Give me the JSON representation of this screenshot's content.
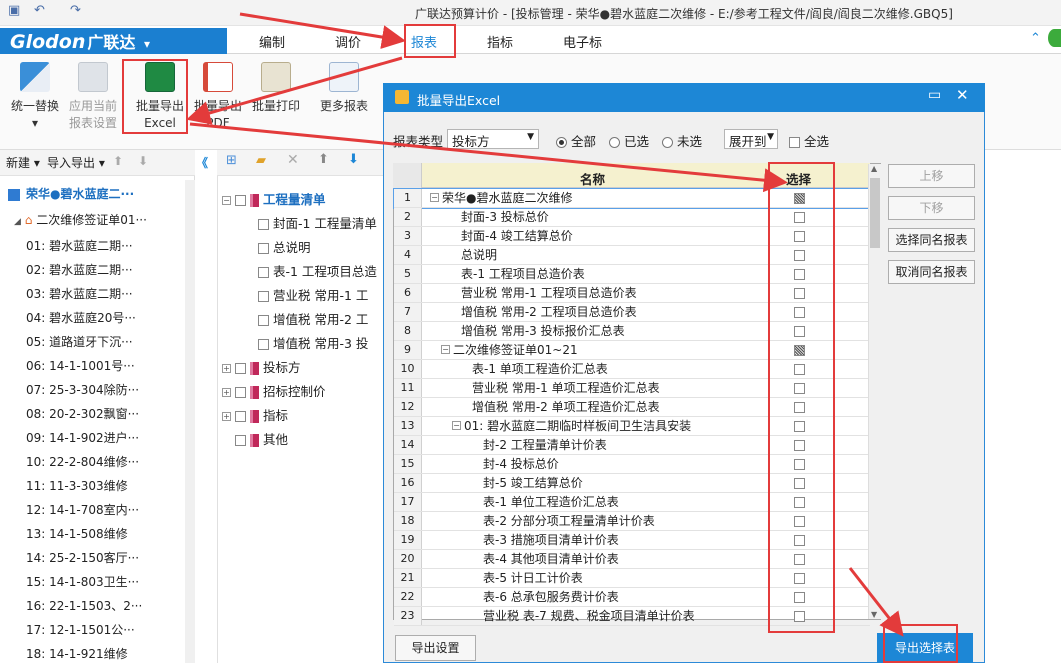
{
  "window": {
    "title": "广联达预算计价 - [投标管理 - 荣华●碧水蓝庭二次维修 - E:/参考工程文件/阎良/阎良二次维修.GBQ5]"
  },
  "brand": {
    "name": "Glodon",
    "cn": "广联达",
    "dropdown": "▾"
  },
  "menu": {
    "tabs": [
      "编制",
      "调价",
      "报表",
      "指标",
      "电子标"
    ],
    "active": "报表"
  },
  "ribbon": {
    "buttons": [
      {
        "label1": "统一替换",
        "label2": "▾",
        "icon": "replace-icon",
        "enabled": true
      },
      {
        "label1": "应用当前",
        "label2": "报表设置",
        "icon": "apply-settings-icon",
        "enabled": false
      },
      {
        "label1": "批量导出",
        "label2": "Excel",
        "icon": "excel-export-icon",
        "enabled": true
      },
      {
        "label1": "批量导出",
        "label2": "PDF",
        "icon": "pdf-export-icon",
        "enabled": true
      },
      {
        "label1": "批量打印",
        "label2": "",
        "icon": "print-icon",
        "enabled": true
      },
      {
        "label1": "更多报表",
        "label2": "",
        "icon": "more-reports-icon",
        "enabled": true
      }
    ]
  },
  "left": {
    "toolbar": {
      "new_label": "新建 ▾",
      "import_export": "导入导出 ▾",
      "collapse": "《"
    },
    "root": "荣华●碧水蓝庭二···",
    "group": "二次维修签证单01···",
    "items": [
      "01: 碧水蓝庭二期···",
      "02: 碧水蓝庭二期···",
      "03: 碧水蓝庭二期···",
      "04: 碧水蓝庭20号···",
      "05: 道路道牙下沉···",
      "06: 14-1-1001号···",
      "07: 25-3-304除防···",
      "08: 20-2-302飘窗···",
      "09: 14-1-902进户···",
      "10: 22-2-804维修···",
      "11: 11-3-303维修",
      "12: 14-1-708室内···",
      "13: 14-1-508维修",
      "14: 25-2-150客厅···",
      "15: 14-1-803卫生···",
      "16: 22-1-1503、2···",
      "17: 12-1-1501公···",
      "18: 14-1-921维修"
    ]
  },
  "middle": {
    "tree": [
      {
        "label": "工程量清单",
        "level": 0,
        "expand": "minus",
        "book": true,
        "bold": true
      },
      {
        "label": "封面-1 工程量清单",
        "level": 1
      },
      {
        "label": "总说明",
        "level": 1
      },
      {
        "label": "表-1 工程项目总造",
        "level": 1
      },
      {
        "label": "营业税 常用-1 工",
        "level": 1
      },
      {
        "label": "增值税 常用-2 工",
        "level": 1
      },
      {
        "label": "增值税 常用-3 投",
        "level": 1
      },
      {
        "label": "投标方",
        "level": 0,
        "expand": "plus",
        "book": true
      },
      {
        "label": "招标控制价",
        "level": 0,
        "expand": "plus",
        "book": true
      },
      {
        "label": "指标",
        "level": 0,
        "expand": "plus",
        "book": true
      },
      {
        "label": "其他",
        "level": 0,
        "book": true
      }
    ]
  },
  "dialog": {
    "title": "批量导出Excel",
    "report_type_label": "报表类型",
    "report_type_value": "投标方",
    "radios": [
      "全部",
      "已选",
      "未选"
    ],
    "radio_selected": "全部",
    "expand_label": "展开到",
    "select_all": "全选",
    "columns": {
      "name": "名称",
      "select": "选择"
    },
    "rows": [
      {
        "n": "1",
        "name": "荣华●碧水蓝庭二次维修",
        "indent": 0,
        "expand": "minus",
        "check": "part"
      },
      {
        "n": "2",
        "name": "封面-3 投标总价",
        "indent": 1
      },
      {
        "n": "3",
        "name": "封面-4 竣工结算总价",
        "indent": 1
      },
      {
        "n": "4",
        "name": "总说明",
        "indent": 1
      },
      {
        "n": "5",
        "name": "表-1 工程项目总造价表",
        "indent": 1
      },
      {
        "n": "6",
        "name": "营业税 常用-1 工程项目总造价表",
        "indent": 1
      },
      {
        "n": "7",
        "name": "增值税 常用-2 工程项目总造价表",
        "indent": 1
      },
      {
        "n": "8",
        "name": "增值税 常用-3 投标报价汇总表",
        "indent": 1
      },
      {
        "n": "9",
        "name": "二次维修签证单01~21",
        "indent": 1,
        "expand": "minus",
        "check": "part"
      },
      {
        "n": "10",
        "name": "表-1 单项工程造价汇总表",
        "indent": 2
      },
      {
        "n": "11",
        "name": "营业税 常用-1 单项工程造价汇总表",
        "indent": 2
      },
      {
        "n": "12",
        "name": "增值税 常用-2 单项工程造价汇总表",
        "indent": 2
      },
      {
        "n": "13",
        "name": "01: 碧水蓝庭二期临时样板间卫生洁具安装",
        "indent": 2,
        "expand": "minus"
      },
      {
        "n": "14",
        "name": "封-2 工程量清单计价表",
        "indent": 3
      },
      {
        "n": "15",
        "name": "封-4 投标总价",
        "indent": 3
      },
      {
        "n": "16",
        "name": "封-5 竣工结算总价",
        "indent": 3
      },
      {
        "n": "17",
        "name": "表-1 单位工程造价汇总表",
        "indent": 3
      },
      {
        "n": "18",
        "name": "表-2 分部分项工程量清单计价表",
        "indent": 3
      },
      {
        "n": "19",
        "name": "表-3 措施项目清单计价表",
        "indent": 3
      },
      {
        "n": "20",
        "name": "表-4 其他项目清单计价表",
        "indent": 3
      },
      {
        "n": "21",
        "name": "表-5 计日工计价表",
        "indent": 3
      },
      {
        "n": "22",
        "name": "表-6 总承包服务费计价表",
        "indent": 3
      },
      {
        "n": "23",
        "name": "营业税 表-7 规费、税金项目清单计价表",
        "indent": 3
      }
    ],
    "side_buttons": [
      {
        "label": "上移",
        "enabled": false
      },
      {
        "label": "下移",
        "enabled": false
      },
      {
        "label": "选择同名报表",
        "enabled": true
      },
      {
        "label": "取消同名报表",
        "enabled": true
      }
    ],
    "export_settings": "导出设置",
    "export_selected": "导出选择表"
  },
  "colors": {
    "accent": "#1d87d6",
    "annotation": "#e33b3b",
    "header_band": "#f5f1cf"
  }
}
